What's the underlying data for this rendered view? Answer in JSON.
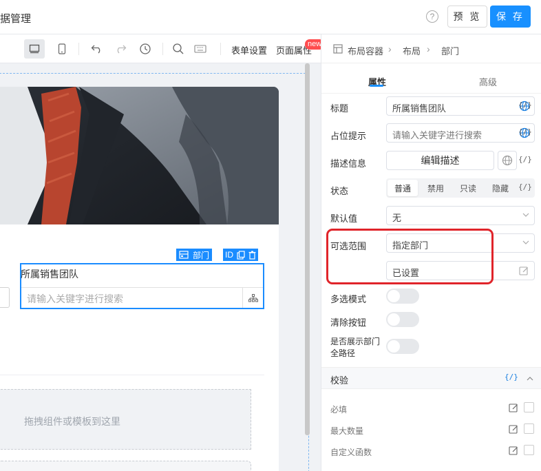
{
  "header": {
    "title": "据管理",
    "help": "?",
    "preview_label": "预 览",
    "save_label": "保 存"
  },
  "toolbar": {
    "form_settings": "表单设置",
    "page_props": "页面属性",
    "new_badge": "new"
  },
  "canvas": {
    "selected_tag_label": "部门",
    "id_tag": "ID",
    "field_label": "所属销售团队",
    "field_placeholder": "请输入关键字进行搜索",
    "drop_hint": "拖拽组件或模板到这里"
  },
  "breadcrumb": [
    "布局容器",
    "布局",
    "部门"
  ],
  "tabs": [
    "属性",
    "高级"
  ],
  "props": {
    "title_label": "标题",
    "title_value": "所属销售团队",
    "placeholder_label": "占位提示",
    "placeholder_value": "请输入关键字进行搜索",
    "desc_label": "描述信息",
    "desc_button": "编辑描述",
    "status_label": "状态",
    "status_options": [
      "普通",
      "禁用",
      "只读",
      "隐藏"
    ],
    "default_label": "默认值",
    "default_value": "无",
    "range_label": "可选范围",
    "range_value": "指定部门",
    "range_set": "已设置",
    "multi_label": "多选模式",
    "clear_label": "清除按钮",
    "fullpath_label_1": "是否展示部门",
    "fullpath_label_2": "全路径",
    "code_tag": "{/}"
  },
  "validation": {
    "title": "校验",
    "code_tag": "{/}",
    "items": [
      "必填",
      "最大数量",
      "自定义函数"
    ]
  },
  "colors": {
    "accent": "#1890ff",
    "highlight": "#e0242a",
    "badge": "#ff4d4f"
  }
}
